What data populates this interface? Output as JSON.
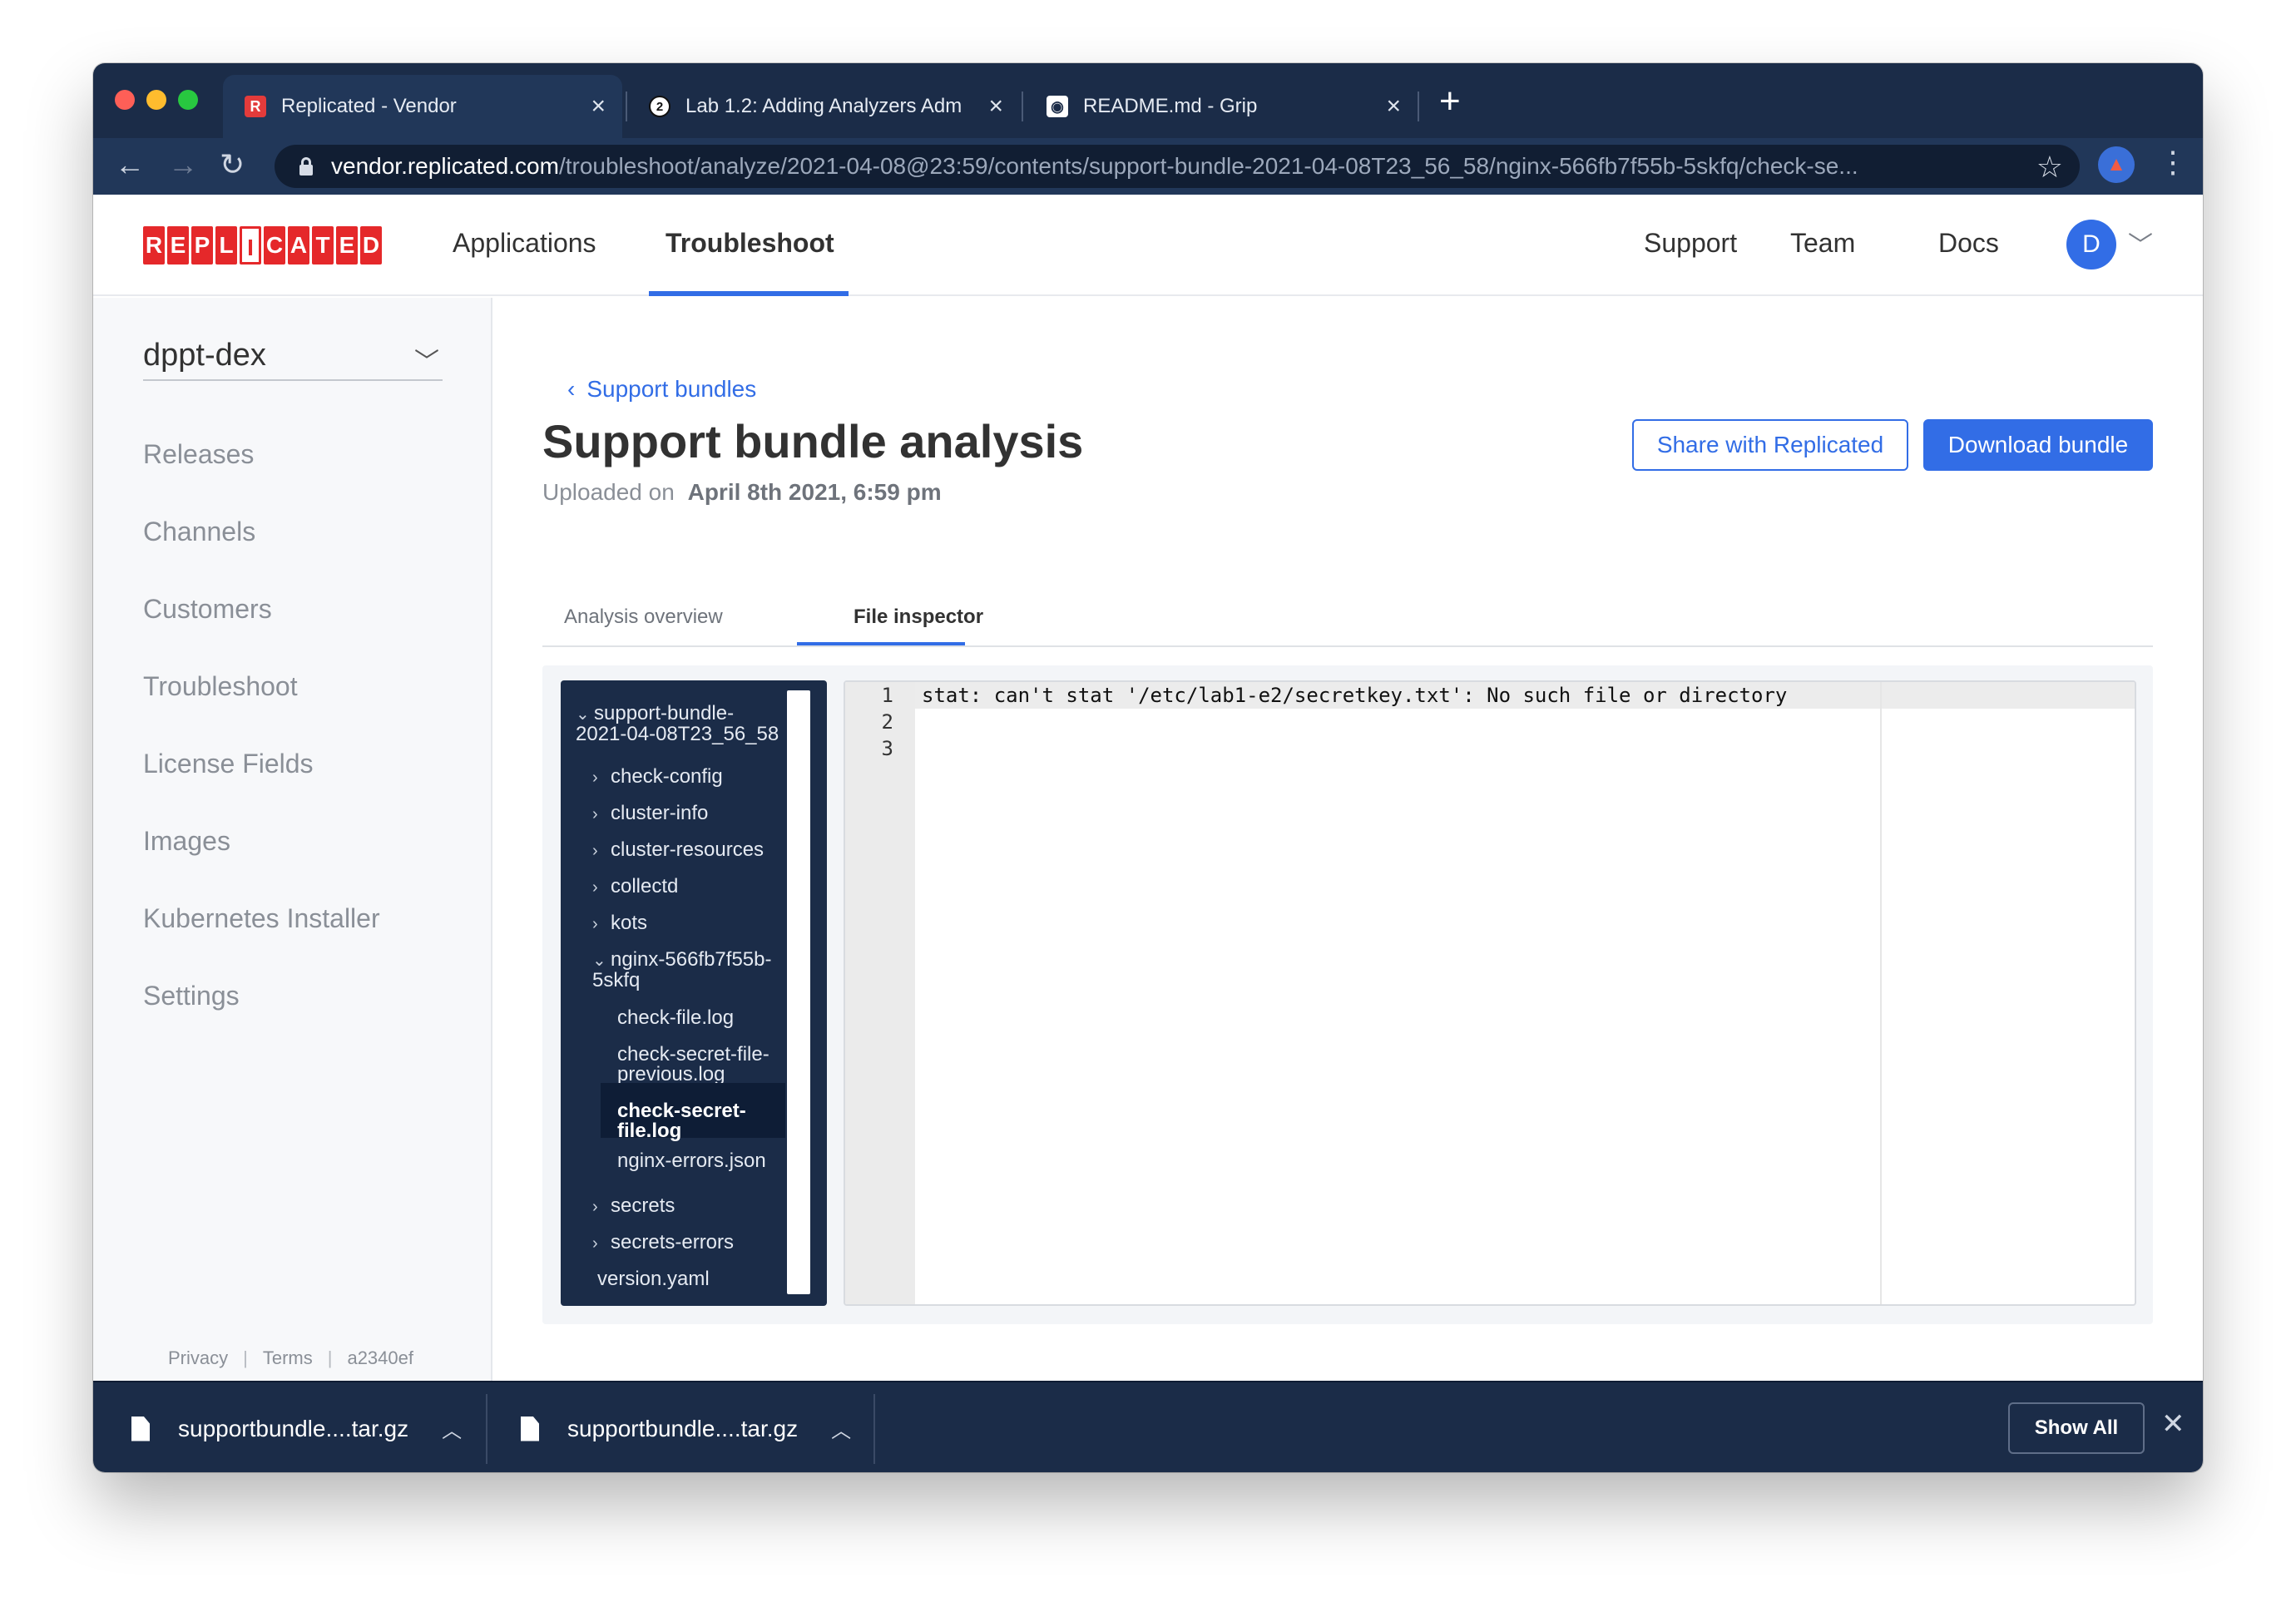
{
  "browser": {
    "tabs": [
      {
        "favicon": "replicated-favicon",
        "title": "Replicated - Vendor",
        "active": true
      },
      {
        "favicon": "lab-favicon",
        "title": "Lab 1.2: Adding Analyzers Adm",
        "active": false
      },
      {
        "favicon": "github-favicon",
        "title": "README.md - Grip",
        "active": false
      }
    ],
    "url_host": "vendor.replicated.com",
    "url_path": "/troubleshoot/analyze/2021-04-08@23:59/contents/support-bundle-2021-04-08T23_56_58/nginx-566fb7f55b-5skfq/check-se..."
  },
  "header": {
    "logo": "REPLICATED",
    "nav": [
      "Applications",
      "Troubleshoot"
    ],
    "active_nav": "Troubleshoot",
    "right_nav": [
      "Support",
      "Team",
      "Docs"
    ],
    "avatar_initial": "D"
  },
  "sidebar": {
    "app_name": "dppt-dex",
    "items": [
      "Releases",
      "Channels",
      "Customers",
      "Troubleshoot",
      "License Fields",
      "Images",
      "Kubernetes Installer",
      "Settings"
    ],
    "footer": {
      "privacy": "Privacy",
      "terms": "Terms",
      "version": "a2340ef"
    }
  },
  "main": {
    "back_link": "Support bundles",
    "title": "Support bundle analysis",
    "uploaded_label": "Uploaded on",
    "uploaded_date": "April 8th 2021, 6:59 pm",
    "share_button": "Share with Replicated",
    "download_button": "Download bundle",
    "tabs": [
      "Analysis overview",
      "File inspector"
    ],
    "active_tab": "File inspector"
  },
  "file_tree": {
    "root": "support-bundle-\n2021-04-08T23_56_58",
    "folders_top": [
      "check-config",
      "cluster-info",
      "cluster-resources",
      "collectd",
      "kots"
    ],
    "open_folder": "nginx-566fb7f55b-\n5skfq",
    "open_folder_files": [
      "check-file.log",
      "check-secret-file-\nprevious.log",
      "check-secret-\nfile.log",
      "nginx-errors.json"
    ],
    "selected_file": "check-secret-file.log",
    "folders_bottom": [
      "secrets",
      "secrets-errors"
    ],
    "root_files": [
      "version.yaml"
    ]
  },
  "editor": {
    "line_numbers": [
      "1",
      "2",
      "3"
    ],
    "lines": [
      "stat: can't stat '/etc/lab1-e2/secretkey.txt': No such file or directory",
      "",
      ""
    ]
  },
  "downloads": {
    "items": [
      "supportbundle....tar.gz",
      "supportbundle....tar.gz"
    ],
    "show_all": "Show All"
  }
}
